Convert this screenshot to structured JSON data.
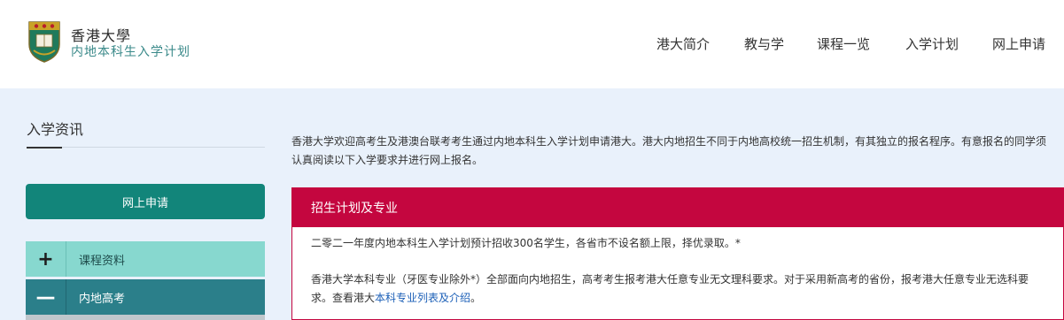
{
  "header": {
    "brand_line1": "香港大學",
    "brand_line2": "内地本科生入学计划",
    "nav": [
      "港大简介",
      "教与学",
      "课程一览",
      "入学计划",
      "网上申请"
    ]
  },
  "sidebar": {
    "title": "入学资讯",
    "apply_button": "网上申请",
    "items": [
      {
        "symbol": "+",
        "label": "课程资料"
      },
      {
        "symbol": "—",
        "label": "内地高考"
      }
    ]
  },
  "main": {
    "intro": "香港大学欢迎高考生及港澳台联考考生通过内地本科生入学计划申请港大。港大内地招生不同于内地高校统一招生机制，有其独立的报名程序。有意报名的同学须认真阅读以下入学要求并进行网上报名。",
    "panel": {
      "title": "招生计划及专业",
      "para1": "二零二一年度内地本科生入学计划预计招收300名学生，各省市不设名额上限，择优录取。*",
      "para2_text": "香港大学本科专业（牙医专业除外*）全部面向内地招生，高考考生报考港大任意专业无文理科要求。对于采用新高考的省份，报考港大任意专业无选科要求。查看港大",
      "para2_link": "本科专业列表及介绍",
      "para2_end": "。"
    }
  },
  "colors": {
    "teal_button": "#12857a",
    "crimson": "#c4063f",
    "light_teal": "#87d8cf",
    "dark_teal": "#2b7f8a",
    "page_bg": "#e9f1fb"
  }
}
